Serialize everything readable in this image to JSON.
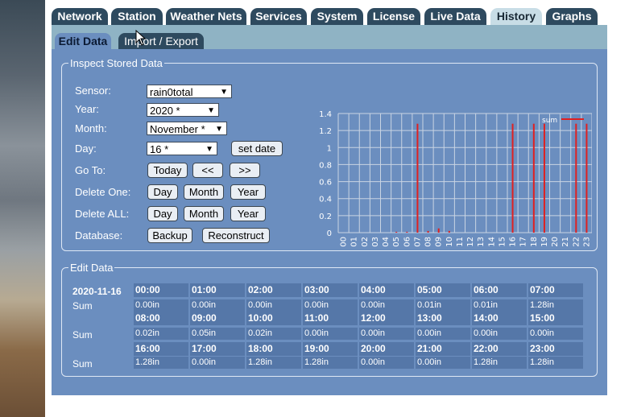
{
  "tabs": [
    {
      "label": "Network",
      "active": false
    },
    {
      "label": "Station",
      "active": false
    },
    {
      "label": "Weather Nets",
      "active": false
    },
    {
      "label": "Services",
      "active": false
    },
    {
      "label": "System",
      "active": false
    },
    {
      "label": "License",
      "active": false
    },
    {
      "label": "Live Data",
      "active": false
    },
    {
      "label": "History",
      "active": true
    },
    {
      "label": "Graphs",
      "active": false
    }
  ],
  "subtabs": [
    {
      "label": "Edit Data",
      "active": true
    },
    {
      "label": "Import / Export",
      "active": false
    }
  ],
  "inspect": {
    "legend": "Inspect Stored Data",
    "sensor_label": "Sensor:",
    "sensor_value": "rain0total",
    "year_label": "Year:",
    "year_value": "2020 *",
    "month_label": "Month:",
    "month_value": "November *",
    "day_label": "Day:",
    "day_value": "16 *",
    "set_date": "set date",
    "goto_label": "Go To:",
    "today": "Today",
    "prev": "<<",
    "next": ">>",
    "delete_one_label": "Delete One:",
    "delete_all_label": "Delete ALL:",
    "day_btn": "Day",
    "month_btn": "Month",
    "year_btn": "Year",
    "database_label": "Database:",
    "backup": "Backup",
    "reconstruct": "Reconstruct"
  },
  "chart_data": {
    "type": "bar",
    "categories": [
      "00",
      "01",
      "02",
      "03",
      "04",
      "05",
      "06",
      "07",
      "08",
      "09",
      "10",
      "11",
      "12",
      "13",
      "14",
      "15",
      "16",
      "17",
      "18",
      "19",
      "20",
      "21",
      "22",
      "23"
    ],
    "series": [
      {
        "name": "sum",
        "values": [
          0,
          0,
          0,
          0,
          0,
          0.01,
          0.01,
          1.28,
          0.02,
          0.05,
          0.02,
          0,
          0,
          0,
          0,
          0,
          1.28,
          0,
          1.28,
          1.28,
          0,
          0,
          1.28,
          1.28
        ]
      }
    ],
    "y_ticks": [
      "0",
      "0.2",
      "0.4",
      "0.6",
      "0.8",
      "1",
      "1.2",
      "1.4"
    ],
    "ylim": [
      0,
      1.4
    ],
    "grid": true,
    "legend": "top-right",
    "color": "#e02020"
  },
  "edit": {
    "legend": "Edit Data",
    "date": "2020-11-16",
    "sum_label": "Sum",
    "rows": [
      {
        "hours": [
          "00:00",
          "01:00",
          "02:00",
          "03:00",
          "04:00",
          "05:00",
          "06:00",
          "07:00"
        ],
        "values": [
          "0.00in",
          "0.00in",
          "0.00in",
          "0.00in",
          "0.00in",
          "0.01in",
          "0.01in",
          "1.28in"
        ]
      },
      {
        "hours": [
          "08:00",
          "09:00",
          "10:00",
          "11:00",
          "12:00",
          "13:00",
          "14:00",
          "15:00"
        ],
        "values": [
          "0.02in",
          "0.05in",
          "0.02in",
          "0.00in",
          "0.00in",
          "0.00in",
          "0.00in",
          "0.00in"
        ]
      },
      {
        "hours": [
          "16:00",
          "17:00",
          "18:00",
          "19:00",
          "20:00",
          "21:00",
          "22:00",
          "23:00"
        ],
        "values": [
          "1.28in",
          "0.00in",
          "1.28in",
          "1.28in",
          "0.00in",
          "0.00in",
          "1.28in",
          "1.28in"
        ]
      }
    ]
  }
}
